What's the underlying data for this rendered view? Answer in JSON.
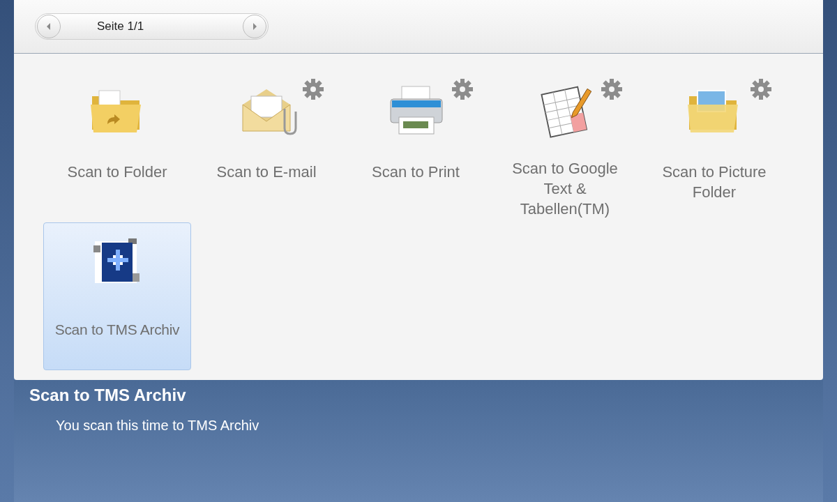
{
  "pager": {
    "label": "Seite 1/1"
  },
  "actions": [
    {
      "kind": "folder",
      "label": "Scan to Folder",
      "settings": false,
      "selected": false
    },
    {
      "kind": "email",
      "label": "Scan to E-mail",
      "settings": true,
      "selected": false
    },
    {
      "kind": "printer",
      "label": "Scan to Print",
      "settings": true,
      "selected": false
    },
    {
      "kind": "document",
      "label": "Scan to Google Text & Tabellen(TM)",
      "settings": true,
      "selected": false
    },
    {
      "kind": "picture-folder",
      "label": "Scan to Picture Folder",
      "settings": true,
      "selected": false
    },
    {
      "kind": "archive",
      "label": "Scan to TMS Archiv",
      "settings": false,
      "selected": true
    }
  ],
  "detail": {
    "title": "Scan to TMS Archiv",
    "description": "You scan this time to TMS Archiv"
  }
}
